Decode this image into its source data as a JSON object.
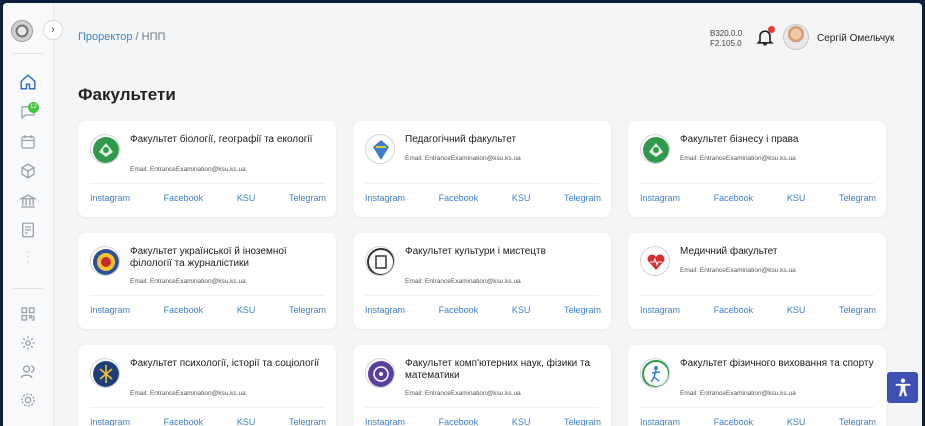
{
  "header": {
    "breadcrumb_link": "Проректор",
    "breadcrumb_sep": "/",
    "breadcrumb_current": "НПП",
    "version_back": "B320.0.0",
    "version_front": "F2.105.0",
    "user_name": "Сергій Омельчук"
  },
  "sidebar": {
    "badge": "12",
    "icons": [
      "home-icon",
      "chat-icon",
      "calendar-icon",
      "cube-icon",
      "bank-icon",
      "document-icon",
      "more-icon",
      "qr-icon",
      "settings-icon",
      "users-icon",
      "gear-icon"
    ]
  },
  "page": {
    "title": "Факультети"
  },
  "colors": {
    "link": "#3b7fd0",
    "accent": "#3f51b5",
    "notification": "#e53935",
    "badge": "#43c43a"
  },
  "faculties": [
    {
      "name": "Факультет біології, географії та екології",
      "email": "Email: EntranceExamination@ksu.ks.ua",
      "emblem": "green"
    },
    {
      "name": "Педагогічний факультет",
      "email": "Email: EntranceExamination@ksu.ks.ua",
      "emblem": "blue"
    },
    {
      "name": "Факультет бізнесу і права",
      "email": "Email: EntranceExamination@ksu.ks.ua",
      "emblem": "green"
    },
    {
      "name": "Факультет української й іноземної філології та журналістики",
      "email": "Email: EntranceExamination@ksu.ks.ua",
      "emblem": "multi"
    },
    {
      "name": "Факультет культури і мистецтв",
      "email": "Email: EntranceExamination@ksu.ks.ua",
      "emblem": "dark"
    },
    {
      "name": "Медичний факультет",
      "email": "Email: EntranceExamination@ksu.ks.ua",
      "emblem": "heart"
    },
    {
      "name": "Факультет психології, історії та соціології",
      "email": "Email: EntranceExamination@ksu.ks.ua",
      "emblem": "navy"
    },
    {
      "name": "Факультет комп'ютерних наук, фізики та математики",
      "email": "Email: EntranceExamination@ksu.ks.ua",
      "emblem": "purple"
    },
    {
      "name": "Факультет фізичного виховання та спорту",
      "email": "Email: EntranceExamination@ksu.ks.ua",
      "emblem": "sport"
    }
  ],
  "links": [
    "Instagram",
    "Facebook",
    "KSU",
    "Telegram"
  ]
}
